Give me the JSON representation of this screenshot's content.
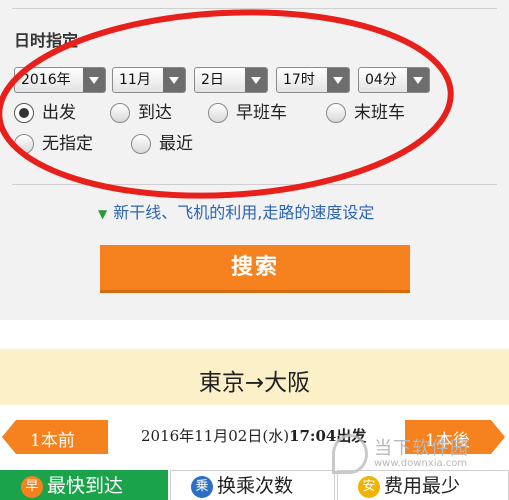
{
  "section": {
    "title": "日时指定"
  },
  "selects": {
    "year": "2016年",
    "month": "11月",
    "day": "2日",
    "hour": "17时",
    "minute": "04分"
  },
  "radios": [
    {
      "label": "出发",
      "checked": true
    },
    {
      "label": "到达",
      "checked": false
    },
    {
      "label": "早班车",
      "checked": false
    },
    {
      "label": "末班车",
      "checked": false
    },
    {
      "label": "无指定",
      "checked": false
    },
    {
      "label": "最近",
      "checked": false
    }
  ],
  "speed_link": {
    "label": "新干线、飞机的利用,走路的速度设定"
  },
  "search_button": {
    "label": "搜索"
  },
  "route": {
    "text": "東京→大阪"
  },
  "nav": {
    "prev": "1本前",
    "next": "1本後"
  },
  "datetime": {
    "date": "2016年11月02日(水)",
    "time": "17:04出发"
  },
  "tabs": [
    {
      "label": "最快到达",
      "icon": "早",
      "active": true
    },
    {
      "label": "换乘次数",
      "icon": "乗",
      "active": false
    },
    {
      "label": "费用最少",
      "icon": "安",
      "active": false
    }
  ],
  "watermark": {
    "text": "当下软件园",
    "url": "www.downxia.com"
  },
  "colors": {
    "accent": "#f5821f",
    "active_tab": "#1aa34a",
    "link": "#2d64b3",
    "annotation": "#e8201c",
    "route_bar": "#fbf0c8"
  }
}
